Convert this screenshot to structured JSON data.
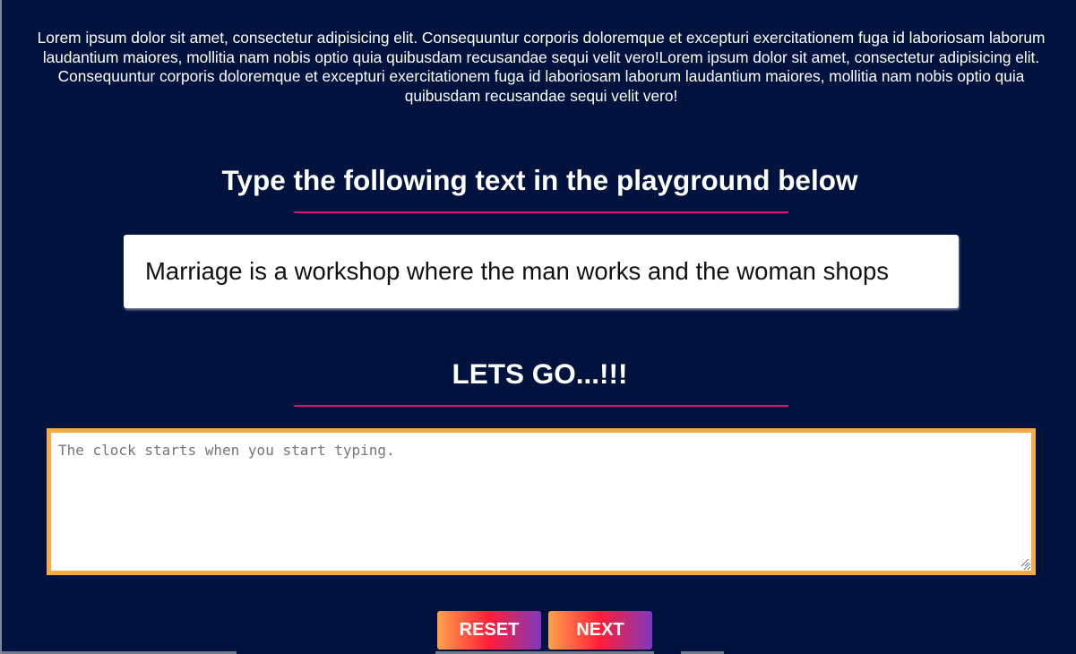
{
  "intro": {
    "text": "Lorem ipsum dolor sit amet, consectetur adipisicing elit. Consequuntur corporis doloremque et excepturi exercitationem fuga id laboriosam laborum laudantium maiores, mollitia nam nobis optio quia quibusdam recusandae sequi velit vero!Lorem ipsum dolor sit amet, consectetur adipisicing elit. Consequuntur corporis doloremque et excepturi exercitationem fuga id laboriosam laborum laudantium maiores, mollitia nam nobis optio quia quibusdam recusandae sequi velit vero!"
  },
  "instructions": {
    "title": "Type the following text in the playground below"
  },
  "quote": {
    "text": "Marriage is a workshop where the man works and the woman shops"
  },
  "playground": {
    "title": "LETS GO...!!!",
    "value": "",
    "placeholder": "The clock starts when you start typing."
  },
  "buttons": {
    "reset_label": "RESET",
    "next_label": "NEXT"
  },
  "colors": {
    "background": "#00133f",
    "accent_underline": "#d9166b",
    "textarea_border": "#f9ab46",
    "button_gradient": [
      "#ffa24c",
      "#ff1d38",
      "#7e39bf"
    ]
  },
  "icons": {
    "resize_handle": "resize-handle-icon"
  }
}
